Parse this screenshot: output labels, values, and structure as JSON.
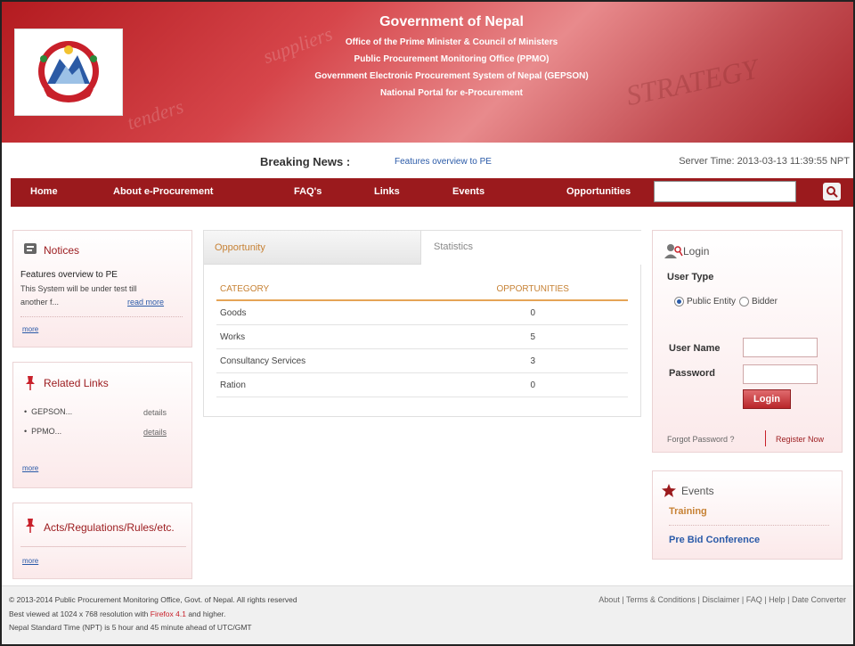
{
  "header": {
    "title": "Government of Nepal",
    "lines": [
      "Office of the Prime Minister & Council of Ministers",
      "Public Procurement Monitoring Office (PPMO)",
      "Government Electronic Procurement System of Nepal (GEPSON)",
      "National Portal for e-Procurement"
    ]
  },
  "news": {
    "label": "Breaking News :",
    "text": "Features overview to PE",
    "server_time": "Server Time: 2013-03-13 11:39:55 NPT"
  },
  "nav": {
    "items": [
      "Home",
      "About e-Procurement",
      "FAQ's",
      "Links",
      "Events",
      "Opportunities"
    ],
    "search_placeholder": ""
  },
  "notices": {
    "title": "Notices",
    "headline": "Features overview to PE",
    "body_line1": "This System will be under test till",
    "body_line2": "another f...",
    "read_more": "read more",
    "more": "more"
  },
  "related": {
    "title": "Related Links",
    "items": [
      {
        "label": "GEPSON...",
        "action": "details"
      },
      {
        "label": "PPMO...",
        "action": "details"
      }
    ],
    "more": "more"
  },
  "acts": {
    "title": "Acts/Regulations/Rules/etc.",
    "more": "more"
  },
  "tabs": {
    "opportunity": "Opportunity",
    "statistics": "Statistics"
  },
  "table": {
    "headers": [
      "CATEGORY",
      "OPPORTUNITIES"
    ],
    "rows": [
      {
        "category": "Goods",
        "count": "0"
      },
      {
        "category": "Works",
        "count": "5"
      },
      {
        "category": "Consultancy Services",
        "count": "3"
      },
      {
        "category": "Ration",
        "count": "0"
      }
    ]
  },
  "login": {
    "title": "Login",
    "user_type_label": "User Type",
    "options": [
      "Public Entity",
      "Bidder"
    ],
    "selected_option": "Public Entity",
    "username_label": "User Name",
    "password_label": "Password",
    "button": "Login",
    "forgot": "Forgot Password ?",
    "register": "Register Now"
  },
  "events": {
    "title": "Events",
    "items": [
      "Training",
      "Pre Bid Conference"
    ]
  },
  "footer": {
    "line1": "© 2013-2014 Public Procurement Monitoring Office, Govt. of Nepal. All rights reserved",
    "line2_prefix": "Best viewed at 1024 x 768 resolution with",
    "line2_link": "Firefox 4.1",
    "line2_suffix": "and higher.",
    "line3": "Nepal Standard Time (NPT) is 5 hour and 45 minute ahead of UTC/GMT",
    "links": [
      "About",
      "Terms & Conditions",
      "Disclaimer",
      "FAQ",
      "Help",
      "Date Converter"
    ]
  },
  "colors": {
    "brand_red": "#9b1a1d",
    "header_red": "#b31b20",
    "table_header": "#c78235",
    "link_blue": "#2a5aa8"
  }
}
